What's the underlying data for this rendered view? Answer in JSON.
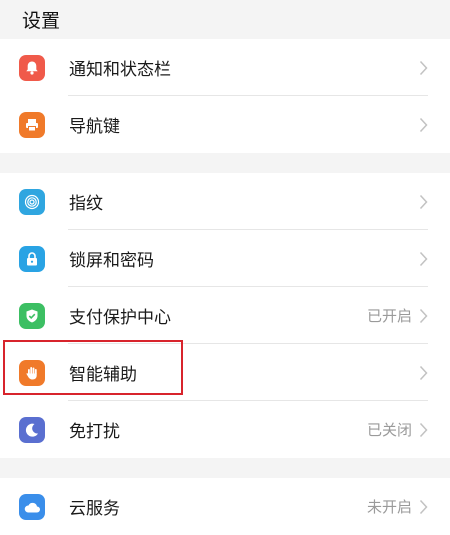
{
  "header": {
    "title": "设置"
  },
  "sections": [
    [
      {
        "label": "通知和状态栏",
        "status": "",
        "icon": "bell-icon",
        "color": "#f05a4a"
      },
      {
        "label": "导航键",
        "status": "",
        "icon": "printer-icon",
        "color": "#f07a2a"
      }
    ],
    [
      {
        "label": "指纹",
        "status": "",
        "icon": "fingerprint-icon",
        "color": "#2fa6e0"
      },
      {
        "label": "锁屏和密码",
        "status": "",
        "icon": "lock-icon",
        "color": "#29a3e4"
      },
      {
        "label": "支付保护中心",
        "status": "已开启",
        "icon": "shield-check-icon",
        "color": "#3cbf63"
      },
      {
        "label": "智能辅助",
        "status": "",
        "icon": "hand-icon",
        "color": "#f07a2a"
      },
      {
        "label": "免打扰",
        "status": "已关闭",
        "icon": "moon-icon",
        "color": "#5a6fd0"
      }
    ],
    [
      {
        "label": "云服务",
        "status": "未开启",
        "icon": "cloud-icon",
        "color": "#3a8eea"
      }
    ]
  ],
  "colors": {
    "highlight_border": "#d8242c",
    "chevron": "#c2c2c2"
  }
}
